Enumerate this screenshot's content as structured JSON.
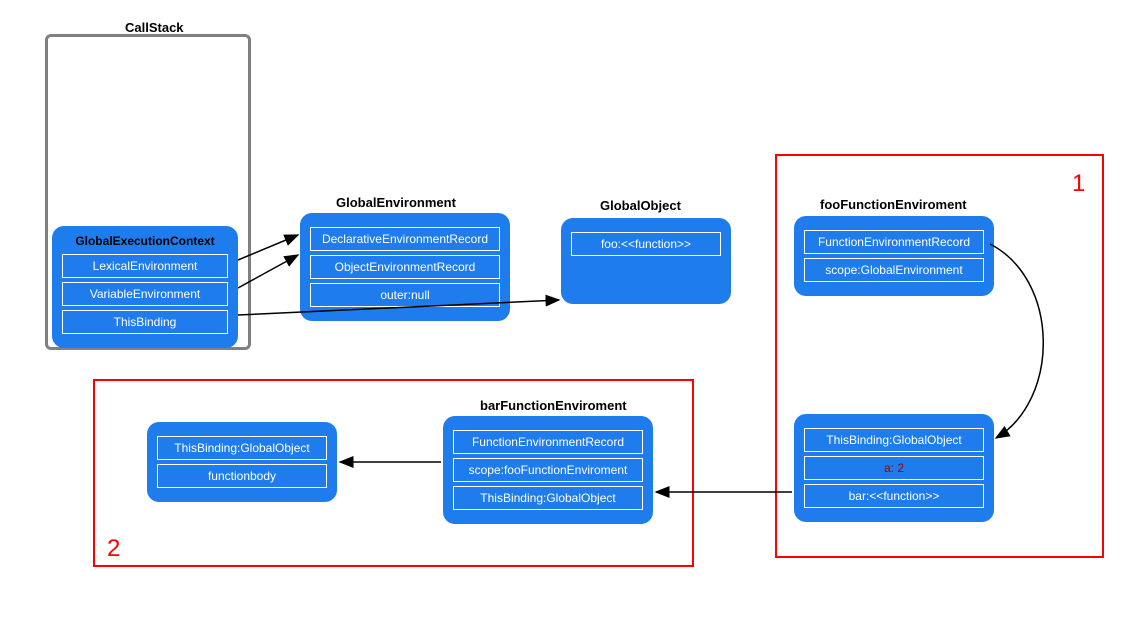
{
  "callstack": {
    "title": "CallStack"
  },
  "globalExecutionContext": {
    "title": "GlobalExecutionContext",
    "rows": [
      "LexicalEnvironment",
      "VariableEnvironment",
      "ThisBinding"
    ]
  },
  "globalEnvironment": {
    "title": "GlobalEnvironment",
    "rows": [
      "DeclarativeEnvironmentRecord",
      "ObjectEnvironmentRecord",
      "outer:null"
    ]
  },
  "globalObject": {
    "title": "GlobalObject",
    "rows": [
      "foo:<<function>>"
    ]
  },
  "fooFunctionEnv": {
    "title": "fooFunctionEnviroment",
    "rows": [
      "FunctionEnvironmentRecord",
      "scope:GlobalEnvironment"
    ]
  },
  "fooBody": {
    "rows": [
      "ThisBinding:GlobalObject",
      "a: 2",
      "bar:<<function>>"
    ],
    "redRowIndex": 1
  },
  "barFunctionEnv": {
    "title": "barFunctionEnviroment",
    "rows": [
      "FunctionEnvironmentRecord",
      "scope:fooFunctionEnviroment",
      "ThisBinding:GlobalObject"
    ]
  },
  "barBody": {
    "rows": [
      "ThisBinding:GlobalObject",
      "functionbody"
    ]
  },
  "regions": {
    "num1": "1",
    "num2": "2"
  }
}
